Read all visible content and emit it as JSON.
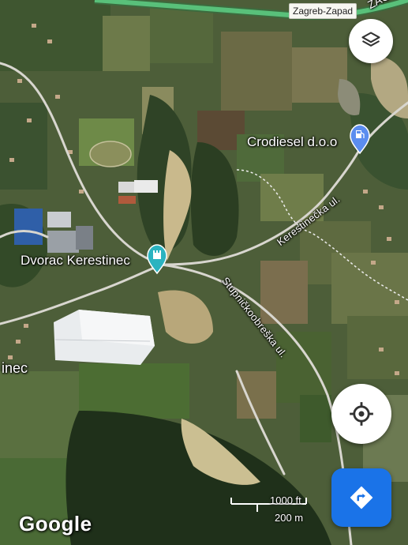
{
  "map": {
    "type": "satellite",
    "highway_sign": "Zagreb-Zapad",
    "highway_partial_label": "ZAGR",
    "places": {
      "dvorac": "Dvorac Kerestinec",
      "crodiesel": "Crodiesel d.o.o",
      "town_partial": "inec"
    },
    "roads": {
      "kerestinecka": "Kerestinečka ul.",
      "stupnicko": "Stupničkoobreška ul."
    },
    "poi_icons": {
      "dvorac": "castle-icon",
      "crodiesel": "gas-station-icon"
    },
    "pin_color_dvorac": "#2bb3c0",
    "pin_color_crodiesel": "#5b8def"
  },
  "controls": {
    "layers_icon": "layers-icon",
    "locate_icon": "my-location-icon",
    "directions_icon": "directions-icon",
    "directions_color": "#1a73e8"
  },
  "scale": {
    "imperial": "1000 ft",
    "metric": "200 m"
  },
  "attribution": {
    "logo": "Google"
  }
}
